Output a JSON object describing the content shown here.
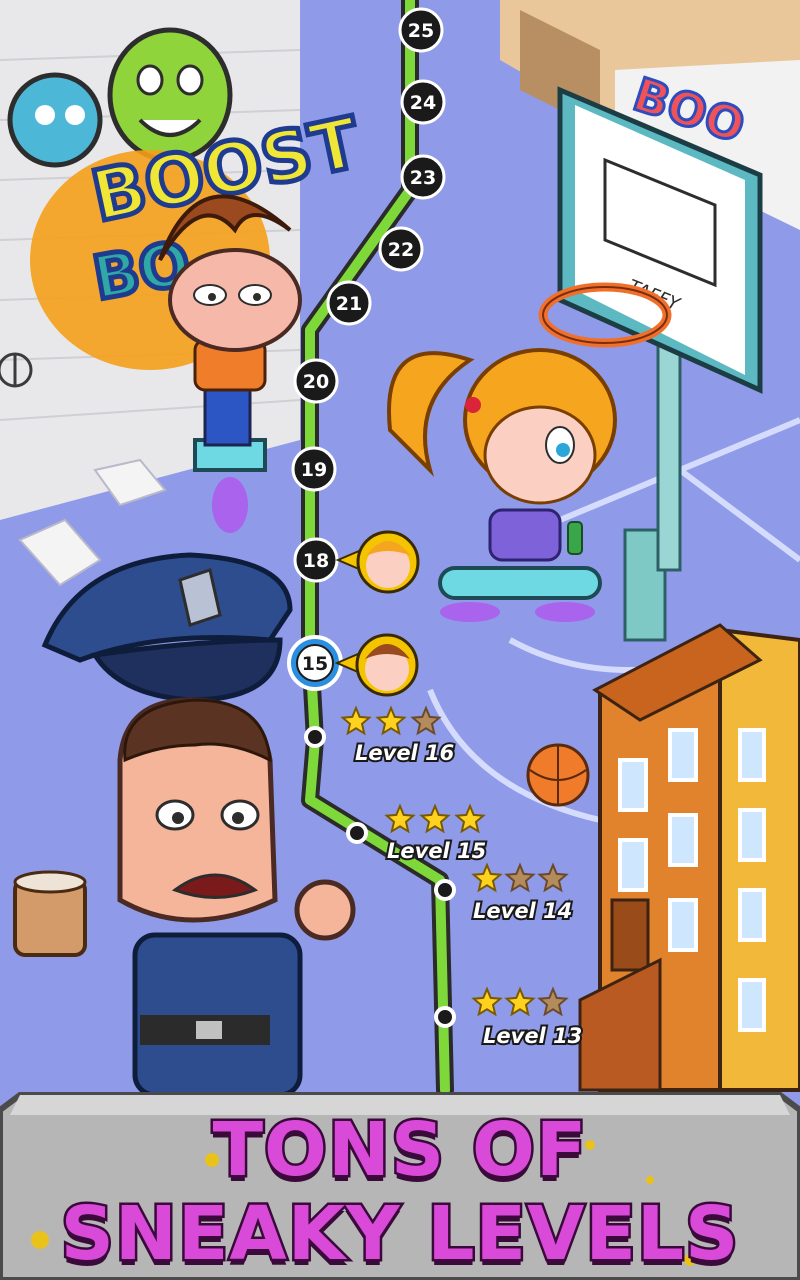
{
  "map": {
    "nodes": [
      {
        "number": "25"
      },
      {
        "number": "24"
      },
      {
        "number": "23"
      },
      {
        "number": "22"
      },
      {
        "number": "21"
      },
      {
        "number": "20"
      },
      {
        "number": "19"
      },
      {
        "number": "18"
      },
      {
        "number": "15",
        "current": true
      }
    ],
    "completed_levels": [
      {
        "label": "Level 16",
        "stars": 2
      },
      {
        "label": "Level 15",
        "stars": 3
      },
      {
        "label": "Level 14",
        "stars": 1
      },
      {
        "label": "Level 13",
        "stars": 2
      }
    ],
    "graffiti_tags": {
      "wall_tag": "BOOST",
      "board_tag": "TAFFY"
    }
  },
  "banner": {
    "line1": "TONS OF",
    "line2": "SNEAKY LEVELS"
  },
  "colors": {
    "path_green": "#7fd83a",
    "background": "#8f9be8",
    "banner_text": "#d94ad8",
    "banner_outline": "#3a0b3a",
    "star_gold": "#ffd21f",
    "star_empty": "#b38b5c"
  }
}
